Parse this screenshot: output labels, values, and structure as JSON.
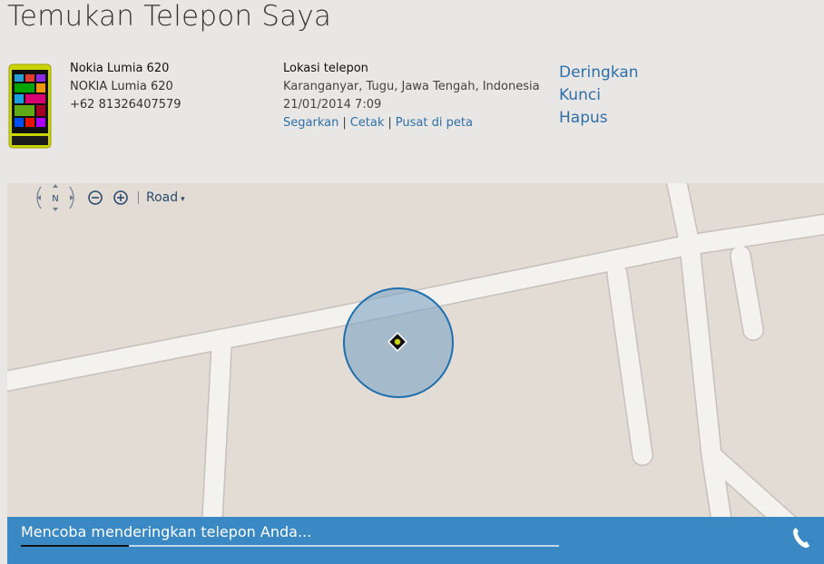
{
  "page": {
    "title": "Temukan Telepon Saya"
  },
  "device": {
    "name": "Nokia Lumia 620",
    "model": "NOKIA Lumia 620",
    "number": "+62 81326407579"
  },
  "location": {
    "heading": "Lokasi telepon",
    "address": "Karanganyar, Tugu, Jawa Tengah, Indonesia",
    "timestamp": "21/01/2014 7:09",
    "links": {
      "refresh": "Segarkan",
      "print": "Cetak",
      "center": "Pusat di peta"
    },
    "separator": "|"
  },
  "actions": {
    "ring": "Deringkan",
    "lock": "Kunci",
    "erase": "Hapus"
  },
  "map_controls": {
    "compass_label": "N",
    "map_type": "Road",
    "map_type_caret": "▾"
  },
  "status": {
    "message": "Mencoba menderingkan telepon Anda...",
    "progress": 0.2
  },
  "colors": {
    "accent": "#2f6fa8",
    "status_bar": "#3a88c4",
    "map_bg": "#e3dcd5",
    "road": "#f4f2ef",
    "accuracy_circle": "#7fa7c7"
  },
  "icons": [
    "phone-thumbnail",
    "compass-icon",
    "zoom-out-icon",
    "zoom-in-icon",
    "location-marker-icon",
    "phone-call-icon"
  ]
}
